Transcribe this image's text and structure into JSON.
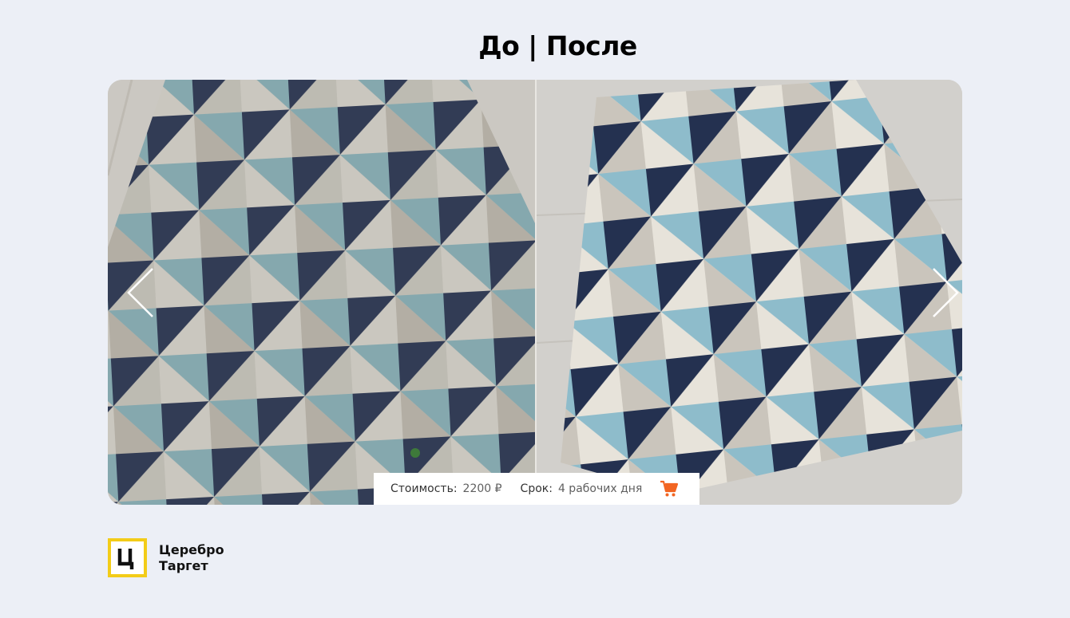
{
  "page": {
    "title": "До | После"
  },
  "slider": {
    "prev_icon": "chevron-left-icon",
    "next_icon": "chevron-right-icon",
    "before_photo": "dirty-geometric-carpet-photo",
    "after_photo": "clean-geometric-carpet-photo"
  },
  "info": {
    "cost_label": "Стоимость:",
    "cost_value": "2200 ₽",
    "term_label": "Срок:",
    "term_value": "4 рабочих дня",
    "cart_icon": "cart-icon"
  },
  "logo": {
    "mark": "Ц",
    "line1": "Церебро",
    "line2": "Таргет"
  },
  "colors": {
    "background": "#eceff6",
    "cart": "#f26522",
    "logo_border": "#f3cc18",
    "navy": "#2a3552",
    "teal": "#8bb8c4",
    "beige": "#cfcac2"
  }
}
